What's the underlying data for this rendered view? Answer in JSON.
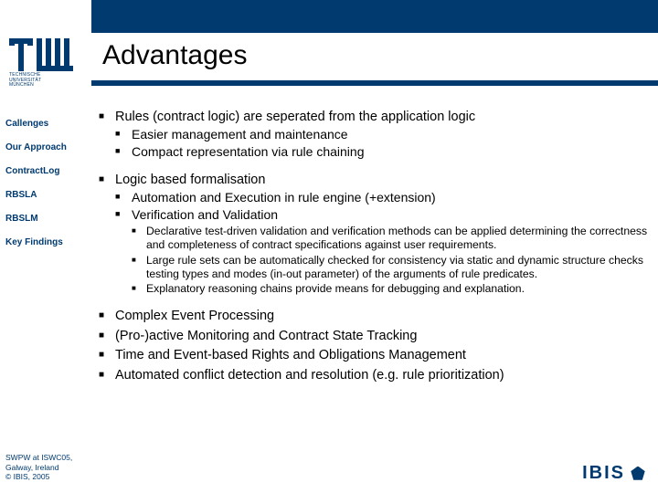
{
  "header": {
    "title": "Advantages",
    "institution_lines": [
      "TECHNISCHE",
      "UNIVERSITÄT",
      "MÜNCHEN"
    ]
  },
  "sidebar": {
    "items": [
      {
        "label": "Callenges"
      },
      {
        "label": "Our Approach"
      },
      {
        "label": "ContractLog"
      },
      {
        "label": "RBSLA"
      },
      {
        "label": "RBSLM"
      },
      {
        "label": "Key Findings"
      }
    ]
  },
  "content": {
    "b1": [
      {
        "text": "Rules (contract logic) are seperated from the application logic",
        "sub": [
          {
            "text": "Easier management and maintenance"
          },
          {
            "text": "Compact representation via rule chaining"
          }
        ]
      },
      {
        "text": "Logic based formalisation",
        "sub": [
          {
            "text": "Automation and Execution in rule engine (+extension)"
          },
          {
            "text": "Verification and Validation",
            "sub3": [
              {
                "text": "Declarative test-driven validation and verification methods can be applied determining the correctness and completeness of contract specifications against user requirements."
              },
              {
                "text": "Large rule sets can be automatically checked for consistency via static and dynamic structure checks testing types and modes (in-out parameter) of the arguments of rule predicates."
              },
              {
                "text": "Explanatory reasoning chains provide means for debugging and explanation."
              }
            ]
          }
        ]
      },
      {
        "text": "Complex Event Processing"
      },
      {
        "text": "(Pro-)active Monitoring and Contract State Tracking"
      },
      {
        "text": "Time and Event-based Rights and Obligations Management"
      },
      {
        "text": "Automated conflict detection and resolution (e.g. rule prioritization)"
      }
    ]
  },
  "footer": {
    "lines": [
      "SWPW at ISWC05,",
      "Galway, Ireland",
      "© IBIS, 2005"
    ],
    "brand": "IBIS"
  }
}
